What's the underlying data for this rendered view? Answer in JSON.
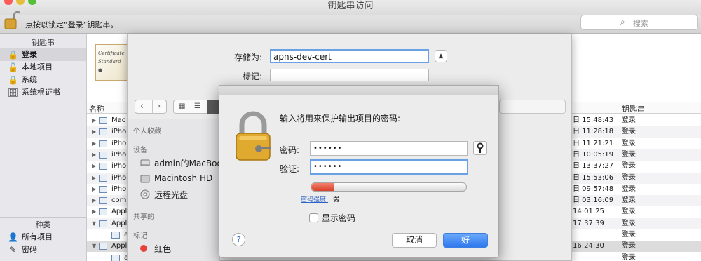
{
  "window": {
    "title": "钥匙串访问",
    "traffic_colors": {
      "close": "#fc5b57",
      "minimize": "#e5bf3c",
      "zoom": "#57c038"
    }
  },
  "toolbar": {
    "lock_text": "点按以锁定“登录”钥匙串。",
    "search_placeholder": "搜索"
  },
  "sidebar": {
    "keychains_header": "钥匙串",
    "keychains": [
      {
        "label": "登录",
        "icon": "lock-icon"
      },
      {
        "label": "本地项目",
        "icon": "unlock-icon"
      },
      {
        "label": "系统",
        "icon": "lock-icon"
      },
      {
        "label": "系统根证书",
        "icon": "cabinet-icon"
      }
    ],
    "category_header": "种类",
    "categories": [
      {
        "label": "所有项目",
        "icon": "person-icon"
      },
      {
        "label": "密码",
        "icon": "pen-icon"
      }
    ]
  },
  "list": {
    "col_name": "名称",
    "col_keychain": "钥匙串",
    "rows": [
      {
        "name": "Mac",
        "date": "日 15:48:43",
        "keychain": "登录"
      },
      {
        "name": "iPho",
        "date": "日 11:28:18",
        "keychain": "登录"
      },
      {
        "name": "iPho",
        "date": "日 11:21:21",
        "keychain": "登录"
      },
      {
        "name": "iPho",
        "date": "日 10:05:19",
        "keychain": "登录"
      },
      {
        "name": "iPho",
        "date": "日 13:37:27",
        "keychain": "登录"
      },
      {
        "name": "iPho",
        "date": "日 15:53:06",
        "keychain": "登录"
      },
      {
        "name": "iPho",
        "date": "日 09:57:48",
        "keychain": "登录"
      },
      {
        "name": "com",
        "date": "日 03:16:09",
        "keychain": "登录"
      },
      {
        "name": "Appl",
        "date": "14:01:25",
        "keychain": "登录"
      },
      {
        "name": "Appl",
        "date": "17:37:39",
        "keychain": "登录"
      },
      {
        "name": "a",
        "date": "",
        "keychain": "登录"
      },
      {
        "name": "Appl",
        "date": "16:24:30",
        "keychain": "登录"
      },
      {
        "name": "a",
        "date": "",
        "keychain": "登录"
      }
    ]
  },
  "save_sheet": {
    "save_as_label": "存储为:",
    "save_as_value": "apns-dev-cert",
    "tags_label": "标记:",
    "favorites_header": "个人收藏",
    "devices_header": "设备",
    "devices": [
      "admin的MacBook",
      "Macintosh HD",
      "远程光盘"
    ],
    "shared_header": "共享的",
    "tags_header": "标记",
    "tags": [
      {
        "label": "红色",
        "color": "#e8413a"
      }
    ]
  },
  "password_dialog": {
    "title": "输入将用来保护输出项目的密码:",
    "password_label": "密码:",
    "password_value": "••••••",
    "verify_label": "验证:",
    "verify_value": "••••••",
    "strength_link": "密码强度:",
    "strength_value": "弱",
    "strength_level": 0.15,
    "show_password_label": "显示密码",
    "cancel_label": "取消",
    "ok_label": "好"
  }
}
